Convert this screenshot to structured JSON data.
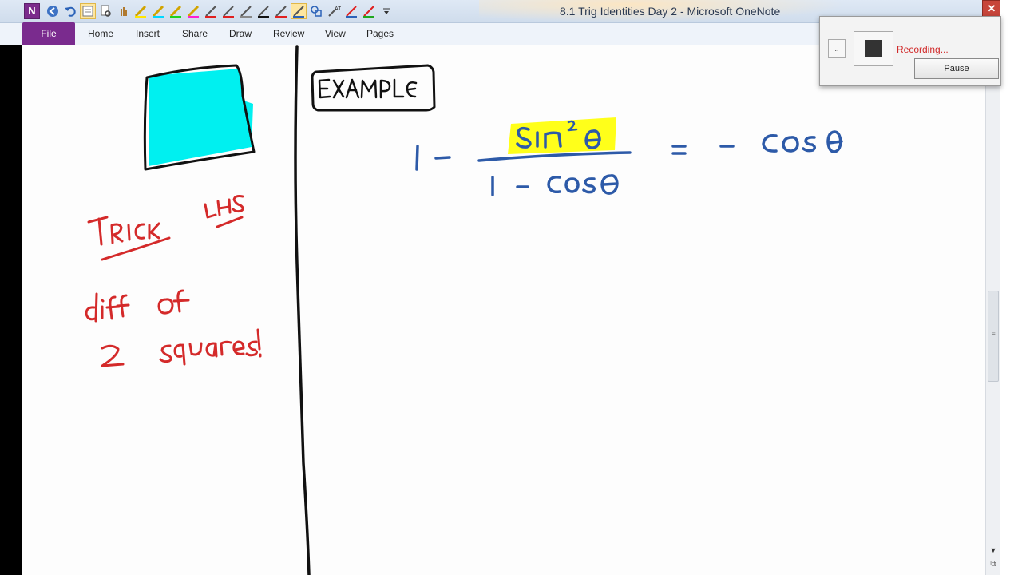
{
  "window": {
    "title": "8.1 Trig Identities Day 2 - Microsoft OneNote",
    "close_glyph": "✕"
  },
  "app_logo": "N",
  "quick_access_icons": [
    "back-icon",
    "undo-icon",
    "dock-icon",
    "print-preview-icon",
    "touch-icon",
    "pen-yellow-icon",
    "pen-cyan-icon",
    "pen-green-icon",
    "pen-magenta-icon",
    "pen-red-icon",
    "pen-gray-icon",
    "pen-black-icon",
    "pen-red-icon",
    "highlighter-icon",
    "shapes-icon",
    "ink-to-text-icon",
    "pen-red-blue-icon",
    "pen-green-icon",
    "customize-icon"
  ],
  "ribbon": {
    "file_label": "File",
    "tabs": [
      "Home",
      "Insert",
      "Share",
      "Draw",
      "Review",
      "View",
      "Pages"
    ]
  },
  "recorder": {
    "small_button": "..",
    "status": "Recording...",
    "pause_label": "Pause"
  },
  "colors": {
    "accent": "#7a2b8e",
    "ink_blue": "#2d5aa8",
    "ink_red": "#d42a2a",
    "highlight": "#ffff1a",
    "shape_fill": "#00f0f0"
  }
}
